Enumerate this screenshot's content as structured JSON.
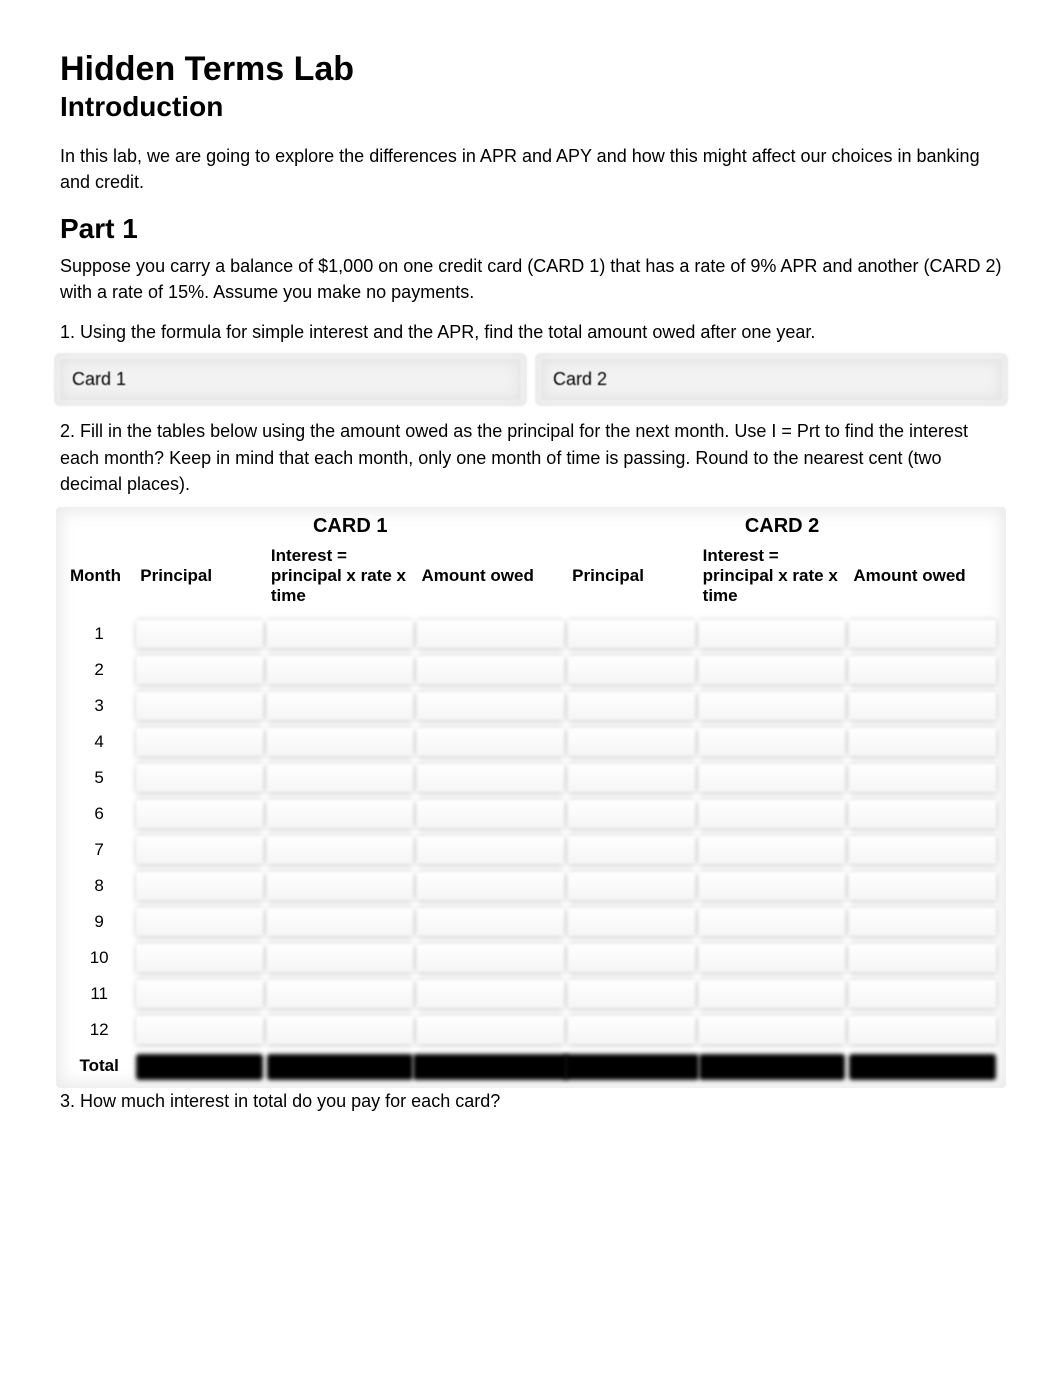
{
  "title": "Hidden Terms Lab",
  "subtitle": "Introduction",
  "intro_para": "In this lab, we are going to explore the differences in APR and APY and how this might affect our choices in banking and credit.",
  "part1_heading": "Part 1",
  "part1_para": "Suppose you carry a balance of $1,000 on one credit card (CARD 1) that has a rate of 9% APR and another (CARD 2) with a rate of 15%. Assume you make no payments.",
  "q1": "1.  Using the formula for simple interest and the APR, find the total amount owed after one year.",
  "answer_labels": {
    "card1": "Card 1",
    "card2": "Card 2"
  },
  "q2": "2.  Fill in the tables below using the amount owed as the principal for the next month. Use I = Prt to find the interest each month? Keep in mind that each month, only one month of time is passing. Round to the nearest cent (two decimal places).",
  "table": {
    "group1": "CARD 1",
    "group2": "CARD 2",
    "cols": {
      "month": "Month",
      "principal": "Principal",
      "interest": "Interest = principal x rate x time",
      "amount": "Amount owed"
    },
    "months": [
      "1",
      "2",
      "3",
      "4",
      "5",
      "6",
      "7",
      "8",
      "9",
      "10",
      "11",
      "12"
    ],
    "total_label": "Total"
  },
  "q3": "3.  How much interest in total do you pay for each card?"
}
